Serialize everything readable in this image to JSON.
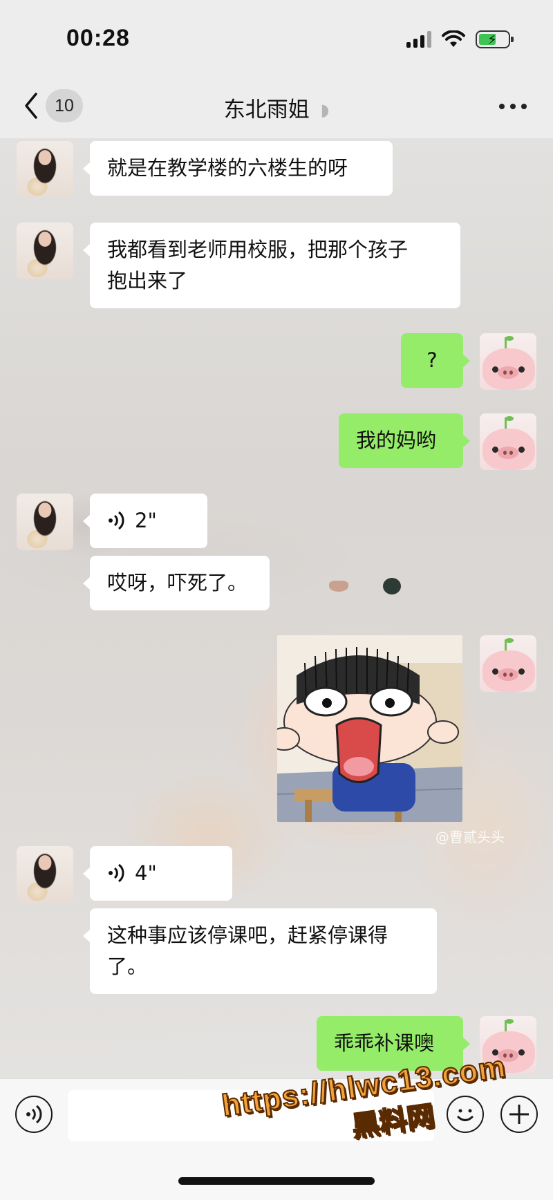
{
  "status_bar": {
    "time": "00:28",
    "battery_color": "#3ec452"
  },
  "nav": {
    "back_icon": "chevron-left-icon",
    "unread_count": "10",
    "title": "东北雨姐",
    "mute_icon": "speaker-muted-icon",
    "more_icon": "more-dots-icon"
  },
  "messages": [
    {
      "from": "them",
      "type": "text",
      "text": "就是在教学楼的六楼生的呀"
    },
    {
      "from": "them",
      "type": "text",
      "lines": [
        "我都看到老师用校服，把那个孩子",
        "抱出来了"
      ]
    },
    {
      "from": "me",
      "type": "text",
      "text": "?"
    },
    {
      "from": "me",
      "type": "text",
      "text": "我的妈哟"
    },
    {
      "from": "them",
      "type": "voice",
      "duration": "2\""
    },
    {
      "from": "them",
      "type": "text",
      "text": "哎呀，吓死了。"
    },
    {
      "from": "me",
      "type": "sticker",
      "sticker": "shocked-cartoon-boy"
    },
    {
      "from": "them",
      "type": "voice",
      "duration": "4\""
    },
    {
      "from": "them",
      "type": "text",
      "lines": [
        "这种事应该停课吧，赶紧停课得",
        "了。"
      ]
    },
    {
      "from": "me",
      "type": "text",
      "text": "乖乖补课噢"
    }
  ],
  "sticker_watermark": "@曹贰头头",
  "input_bar": {
    "voice_icon": "voice-mode-icon",
    "emoji_icon": "emoji-icon",
    "plus_icon": "plus-icon",
    "input_value": ""
  },
  "overlay_watermark": {
    "url": "https://hlwc13.com",
    "brand": "黑料网"
  },
  "colors": {
    "outgoing_bubble": "#95ec69",
    "incoming_bubble": "#ffffff",
    "nav_background": "#ededed"
  }
}
